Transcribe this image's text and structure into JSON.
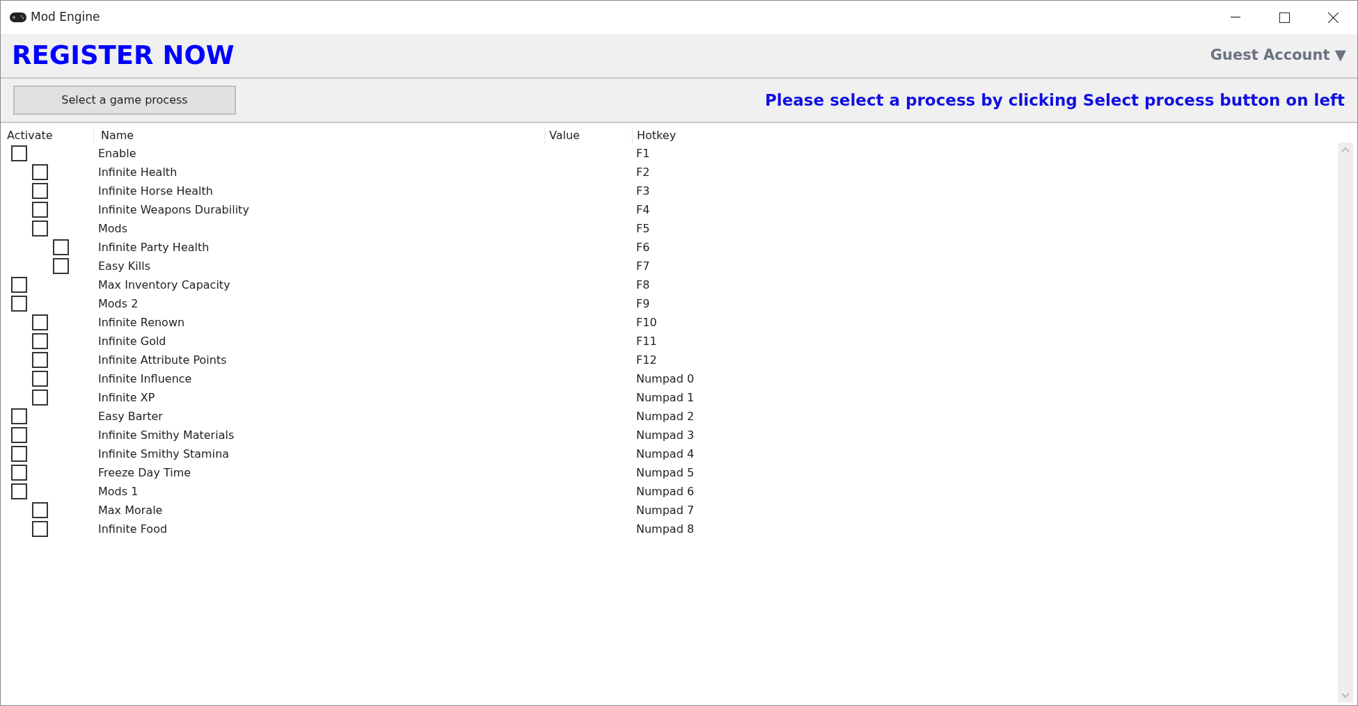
{
  "window": {
    "title": "Mod Engine"
  },
  "header": {
    "banner": "REGISTER NOW",
    "account": "Guest Account ▼"
  },
  "toolbar": {
    "button": "Select a game process",
    "message": "Please select a process by clicking Select process button on left"
  },
  "table": {
    "columns": [
      "Activate",
      "Name",
      "Value",
      "Hotkey"
    ],
    "rows": [
      {
        "name": "Enable",
        "hotkey": "F1",
        "checked": false,
        "children": [
          {
            "name": "Infinite Health",
            "hotkey": "F2",
            "checked": false
          },
          {
            "name": "Infinite Horse Health",
            "hotkey": "F3",
            "checked": false
          },
          {
            "name": "Infinite Weapons Durability",
            "hotkey": "F4",
            "checked": false
          },
          {
            "name": "Mods",
            "hotkey": "F5",
            "checked": false,
            "children": [
              {
                "name": "Infinite Party Health",
                "hotkey": "F6",
                "checked": false
              },
              {
                "name": "Easy Kills",
                "hotkey": "F7",
                "checked": false
              }
            ]
          }
        ]
      },
      {
        "name": "Max Inventory Capacity",
        "hotkey": "F8",
        "checked": false
      },
      {
        "name": "Mods 2",
        "hotkey": "F9",
        "checked": false,
        "children": [
          {
            "name": "Infinite Renown",
            "hotkey": "F10",
            "checked": false
          },
          {
            "name": "Infinite Gold",
            "hotkey": "F11",
            "checked": false
          },
          {
            "name": "Infinite Attribute Points",
            "hotkey": "F12",
            "checked": false
          },
          {
            "name": "Infinite Influence",
            "hotkey": "Numpad 0",
            "checked": false
          },
          {
            "name": "Infinite XP",
            "hotkey": "Numpad 1",
            "checked": false
          }
        ]
      },
      {
        "name": "Easy Barter",
        "hotkey": "Numpad 2",
        "checked": false
      },
      {
        "name": "Infinite Smithy Materials",
        "hotkey": "Numpad 3",
        "checked": false
      },
      {
        "name": "Infinite Smithy Stamina",
        "hotkey": "Numpad 4",
        "checked": false
      },
      {
        "name": "Freeze Day Time",
        "hotkey": "Numpad 5",
        "checked": false
      },
      {
        "name": "Mods 1",
        "hotkey": "Numpad 6",
        "checked": false,
        "children": [
          {
            "name": "Max Morale",
            "hotkey": "Numpad 7",
            "checked": false
          },
          {
            "name": "Infinite Food",
            "hotkey": "Numpad 8",
            "checked": false
          }
        ]
      }
    ]
  }
}
